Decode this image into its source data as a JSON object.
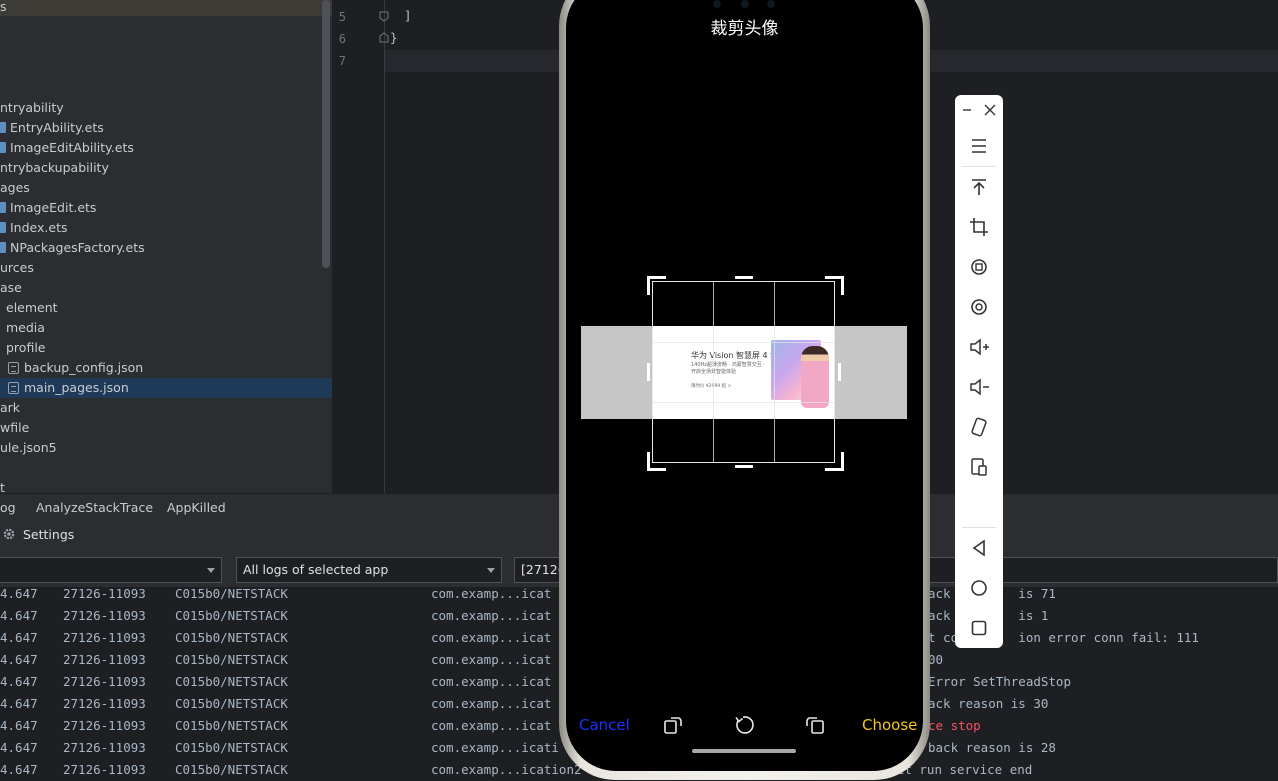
{
  "project_tree": {
    "items": [
      {
        "label": "s",
        "kind": "text"
      },
      {
        "label": "ntryability",
        "kind": "folder"
      },
      {
        "label": "EntryAbility.ets",
        "kind": "file"
      },
      {
        "label": "ImageEditAbility.ets",
        "kind": "file"
      },
      {
        "label": "ntrybackupability",
        "kind": "folder"
      },
      {
        "label": "ages",
        "kind": "folder"
      },
      {
        "label": "ImageEdit.ets",
        "kind": "file"
      },
      {
        "label": "Index.ets",
        "kind": "file"
      },
      {
        "label": "NPackagesFactory.ets",
        "kind": "file"
      },
      {
        "label": "urces",
        "kind": "folder"
      },
      {
        "label": "ase",
        "kind": "folder"
      },
      {
        "label": "element",
        "kind": "folder"
      },
      {
        "label": "media",
        "kind": "folder"
      },
      {
        "label": "profile",
        "kind": "folder"
      },
      {
        "label": "backup_config.json",
        "kind": "json"
      },
      {
        "label": "main_pages.json",
        "kind": "json",
        "selected": true
      },
      {
        "label": "ark",
        "kind": "folder"
      },
      {
        "label": "wfile",
        "kind": "folder"
      },
      {
        "label": "ule.json5",
        "kind": "folder"
      },
      {
        "label": "t",
        "kind": "folder"
      }
    ]
  },
  "editor": {
    "lines": [
      {
        "num": "5",
        "text": "]"
      },
      {
        "num": "6",
        "text": "}"
      },
      {
        "num": "7",
        "text": ""
      }
    ]
  },
  "bottom_tabs": [
    "og",
    "AnalyzeStackTrace",
    "AppKilled"
  ],
  "settings_label": "Settings",
  "filters": {
    "device": "",
    "log_scope": "All logs of selected app",
    "process": "[27126"
  },
  "log": {
    "rows": [
      {
        "time": "4.647",
        "pid": "27126-11093",
        "tag": "C015b0/NETSTACK",
        "pkg": "com.examp...icat",
        "msg": "ack         is 71",
        "color": "#a9b7c6"
      },
      {
        "time": "4.647",
        "pid": "27126-11093",
        "tag": "C015b0/NETSTACK",
        "pkg": "com.examp...icat",
        "msg": "ack         is 1",
        "color": "#a9b7c6"
      },
      {
        "time": "4.647",
        "pid": "27126-11093",
        "tag": "C015b0/NETSTACK",
        "pkg": "com.examp...icat",
        "msg": "t co        ion error conn fail: 111",
        "color": "#a9b7c6"
      },
      {
        "time": "4.647",
        "pid": "27126-11093",
        "tag": "C015b0/NETSTACK",
        "pkg": "com.examp...icat",
        "msg": "00",
        "color": "#a9b7c6"
      },
      {
        "time": "4.647",
        "pid": "27126-11093",
        "tag": "C015b0/NETSTACK",
        "pkg": "com.examp...icat",
        "msg": "Error SetThreadStop",
        "color": "#a9b7c6"
      },
      {
        "time": "4.647",
        "pid": "27126-11093",
        "tag": "C015b0/NETSTACK",
        "pkg": "com.examp...icat",
        "msg": "ack reason is 30",
        "color": "#a9b7c6"
      },
      {
        "time": "4.647",
        "pid": "27126-11093",
        "tag": "C015b0/NETSTACK",
        "pkg": "com.examp...icat",
        "msg": "ce stop",
        "color": "#f75464"
      },
      {
        "time": "4.647",
        "pid": "27126-11093",
        "tag": "C015b0/NETSTACK",
        "pkg": "com.examp...icati",
        "msg": "back reason is 28",
        "color": "#a9b7c6"
      },
      {
        "time": "4.647",
        "pid": "27126-11093",
        "tag": "C015b0/NETSTACK",
        "pkg": "com.examp...ication2  I",
        "msg": "[websocket_exec.cpp:165] websocket run service end",
        "color": "#a9b7c6"
      }
    ]
  },
  "phone": {
    "title": "裁剪头像",
    "cancel_label": "Cancel",
    "choose_label": "Choose",
    "ad": {
      "title": "华为 Vision 智慧屏 4 SE",
      "subtitle": "140Hz超薄流畅 · 鸿蒙智慧交互 · 开启全场景智能体验",
      "price": "限时价 ¥2999 起 >"
    },
    "colors": {
      "cancel": "#1b33ff",
      "choose": "#f5c518"
    }
  },
  "emulator_toolbar": {
    "icons": [
      "minimize-icon",
      "close-icon",
      "menu-icon",
      "pin-top-icon",
      "crop-icon",
      "rotate-left-icon",
      "rotate-right-icon",
      "volume-up-icon",
      "volume-down-icon",
      "shake-icon",
      "screenshot-icon",
      "back-icon",
      "home-icon",
      "recent-apps-icon"
    ]
  }
}
